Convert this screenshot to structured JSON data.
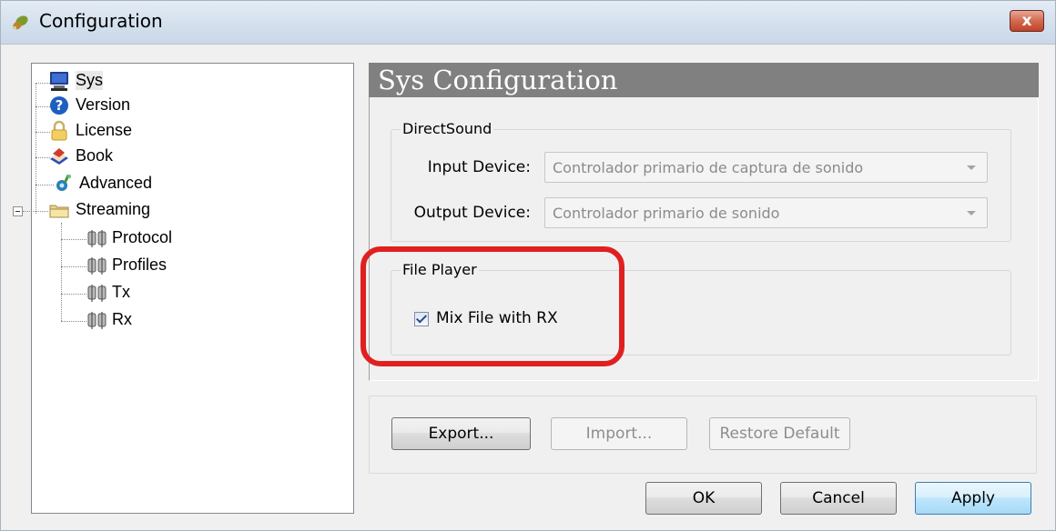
{
  "window": {
    "title": "Configuration",
    "close_symbol": "x"
  },
  "colors": {
    "header_bg": "#808080",
    "highlight": "#e02020",
    "apply_border": "#3c7fb1"
  },
  "tree": {
    "items": [
      {
        "label": "Sys",
        "icon": "computer-icon"
      },
      {
        "label": "Version",
        "icon": "help-question-icon"
      },
      {
        "label": "License",
        "icon": "padlock-icon"
      },
      {
        "label": "Book",
        "icon": "book-icon"
      },
      {
        "label": "Advanced",
        "icon": "settings-icon"
      },
      {
        "label": "Streaming",
        "icon": "folder-icon"
      },
      {
        "label": "Protocol",
        "icon": "network-icon"
      },
      {
        "label": "Profiles",
        "icon": "network-icon"
      },
      {
        "label": "Tx",
        "icon": "network-icon"
      },
      {
        "label": "Rx",
        "icon": "network-icon"
      }
    ]
  },
  "section": {
    "title": "Sys Configuration"
  },
  "directsound": {
    "title": "DirectSound",
    "input_label": "Input Device:",
    "input_value": "Controlador primario de captura de sonido",
    "output_label": "Output Device:",
    "output_value": "Controlador primario de sonido"
  },
  "file_player": {
    "title": "File Player",
    "mix_label": "Mix File with RX",
    "mix_checked": true
  },
  "actions": {
    "export": "Export...",
    "import": "Import...",
    "restore": "Restore Default"
  },
  "dialog_buttons": {
    "ok": "OK",
    "cancel": "Cancel",
    "apply": "Apply"
  }
}
